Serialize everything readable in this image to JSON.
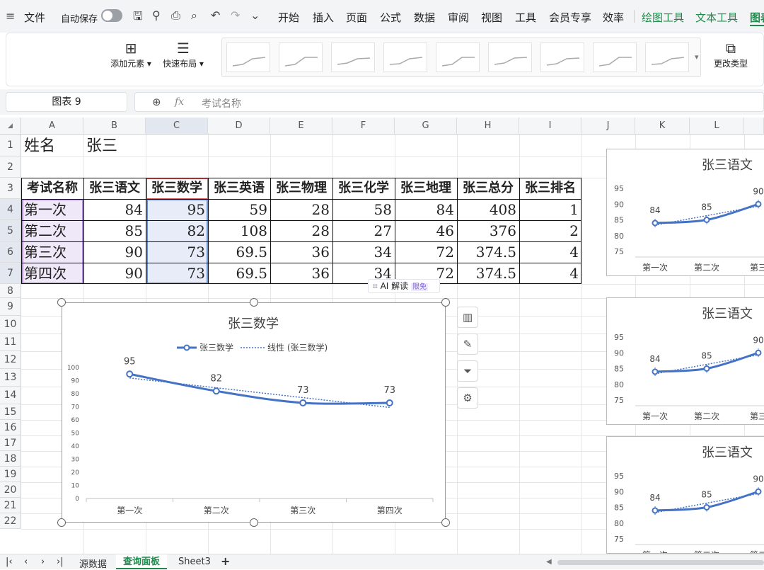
{
  "menubar": {
    "file": "文件",
    "autosave": "自动保存",
    "tabs": [
      "开始",
      "插入",
      "页面",
      "公式",
      "数据",
      "审阅",
      "视图",
      "工具",
      "会员专享",
      "效率"
    ],
    "context_tabs": [
      "绘图工具",
      "文本工具"
    ],
    "cut_tab": "图表"
  },
  "ribbon": {
    "add_element": "添加元素",
    "quick_layout": "快速布局",
    "change_type": "更改类型"
  },
  "formula_bar": {
    "name_box": "图表 9",
    "fx": "fx",
    "content": "考试名称"
  },
  "columns": [
    "A",
    "B",
    "C",
    "D",
    "E",
    "F",
    "G",
    "H",
    "I",
    "J",
    "K",
    "L"
  ],
  "rows": [
    "1",
    "2",
    "3",
    "4",
    "5",
    "6",
    "7",
    "8",
    "9",
    "10",
    "11",
    "12",
    "13",
    "14",
    "15",
    "16",
    "17",
    "18",
    "19",
    "20",
    "21",
    "22"
  ],
  "cells": {
    "a1": "姓名",
    "b1": "张三",
    "headers": [
      "考试名称",
      "张三语文",
      "张三数学",
      "张三英语",
      "张三物理",
      "张三化学",
      "张三地理",
      "张三总分",
      "张三排名"
    ],
    "data": [
      [
        "第一次",
        "84",
        "95",
        "59",
        "28",
        "58",
        "84",
        "408",
        "1"
      ],
      [
        "第二次",
        "85",
        "82",
        "108",
        "28",
        "27",
        "46",
        "376",
        "2"
      ],
      [
        "第三次",
        "90",
        "73",
        "69.5",
        "36",
        "34",
        "72",
        "374.5",
        "4"
      ],
      [
        "第四次",
        "90",
        "73",
        "69.5",
        "36",
        "34",
        "72",
        "374.5",
        "4"
      ]
    ]
  },
  "ai_read": {
    "label": "AI 解读",
    "badge": "限免"
  },
  "chart_data": [
    {
      "type": "line",
      "title": "张三数学",
      "categories": [
        "第一次",
        "第二次",
        "第三次",
        "第四次"
      ],
      "series": [
        {
          "name": "张三数学",
          "values": [
            95,
            82,
            73,
            73
          ]
        }
      ],
      "trendline": {
        "name": "线性 (张三数学)"
      },
      "ylim": [
        0,
        100
      ],
      "yticks": [
        "100",
        "90",
        "80",
        "70",
        "60",
        "50",
        "40",
        "30",
        "20",
        "10",
        "0"
      ],
      "legend": "top",
      "colors": {
        "series": "#4472c4"
      }
    },
    {
      "type": "line",
      "title": "张三语文",
      "categories": [
        "第一次",
        "第二次",
        "第三"
      ],
      "series": [
        {
          "values": [
            84,
            85,
            90
          ]
        }
      ],
      "yticks": [
        "95",
        "90",
        "85",
        "80",
        "75"
      ]
    },
    {
      "type": "line",
      "title": "张三语文",
      "categories": [
        "第一次",
        "第二次",
        "第三"
      ],
      "series": [
        {
          "values": [
            84,
            85,
            90
          ]
        }
      ],
      "yticks": [
        "95",
        "90",
        "85",
        "80",
        "75"
      ]
    },
    {
      "type": "line",
      "title": "张三语文",
      "categories": [
        "第一次",
        "第二次",
        "第二"
      ],
      "series": [
        {
          "values": [
            84,
            85,
            90
          ]
        }
      ],
      "yticks": [
        "95",
        "90",
        "85",
        "80",
        "75"
      ]
    }
  ],
  "sheet_tabs": [
    "源数据",
    "查询面板",
    "Sheet3"
  ],
  "icons": {
    "save": "save-icon",
    "undo": "undo-icon",
    "redo": "redo-icon",
    "search": "zoom-icon"
  }
}
